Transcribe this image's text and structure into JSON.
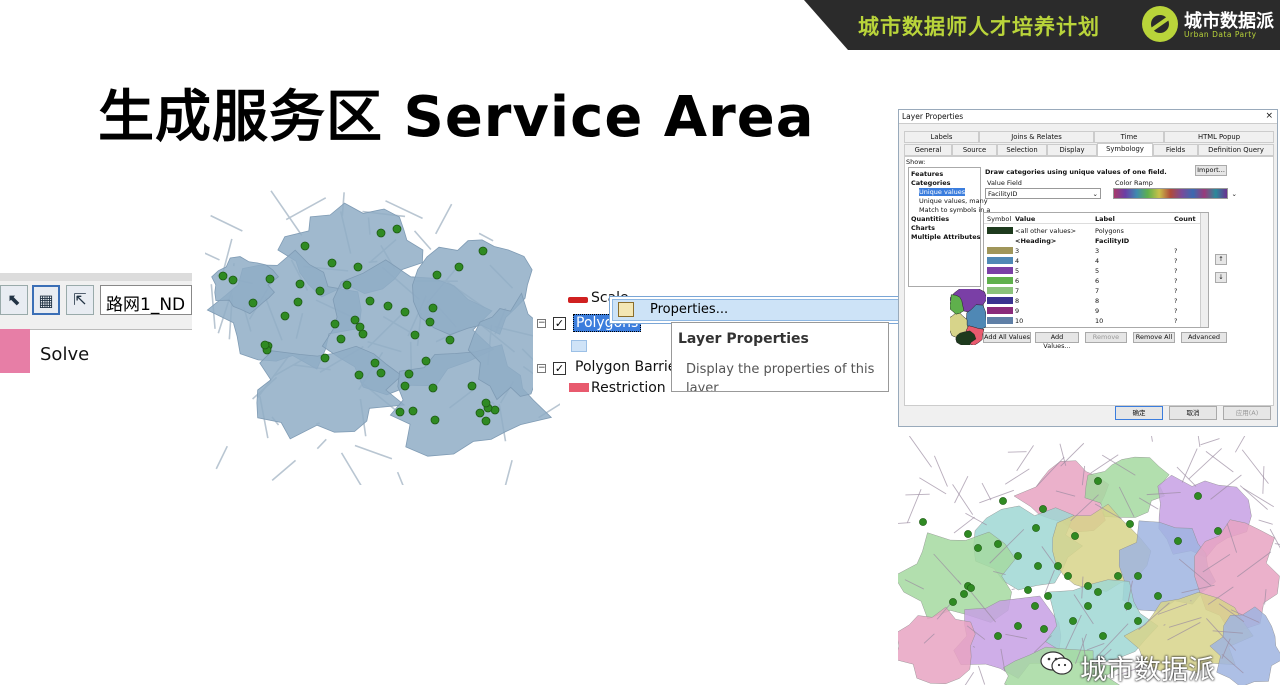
{
  "banner": {
    "slogan": "城市数据师人才培养计划",
    "brand_name": "城市数据派",
    "brand_sub": "Urban Data Party",
    "accent_color": "#b9d43a",
    "bg_color": "#2b2b2b"
  },
  "title": "生成服务区 Service Area",
  "toolbar": {
    "network_name": "路网1_ND",
    "solve_label": "Solve",
    "icons": [
      "select-tool-icon",
      "network-grid-icon",
      "export-icon"
    ]
  },
  "toc": {
    "rows": [
      {
        "label": "Scale",
        "icon": "line-symbol-icon"
      },
      {
        "label": "Polygons",
        "checked": true,
        "selected": true
      },
      {
        "label": "Polygon Barrie",
        "checked": true
      },
      {
        "label": "Restriction",
        "icon": "barrier-symbol-icon"
      }
    ]
  },
  "context_menu": {
    "item_label": "Properties...",
    "icon": "properties-icon"
  },
  "tooltip": {
    "title": "Layer Properties",
    "description": "Display the properties of this layer"
  },
  "dialog": {
    "title": "Layer Properties",
    "close_label": "×",
    "tabs_row1": [
      "Labels",
      "Joins & Relates",
      "Time",
      "HTML Popup"
    ],
    "tabs_row2": [
      "General",
      "Source",
      "Selection",
      "Display",
      "Symbology",
      "Fields",
      "Definition Query"
    ],
    "active_tab": "Symbology",
    "show_label": "Show:",
    "show_items": [
      {
        "label": "Features",
        "bold": true
      },
      {
        "label": "Categories",
        "bold": true
      },
      {
        "label": "Unique values",
        "indent": true,
        "selected": true
      },
      {
        "label": "Unique values, many",
        "indent": true
      },
      {
        "label": "Match to symbols in a",
        "indent": true
      },
      {
        "label": "Quantities",
        "bold": true
      },
      {
        "label": "Charts",
        "bold": true
      },
      {
        "label": "Multiple Attributes",
        "bold": true
      }
    ],
    "description": "Draw categories using unique values of one field.",
    "import_label": "Import...",
    "value_field_label": "Value Field",
    "value_field": "FacilityID",
    "color_ramp_label": "Color Ramp",
    "columns": [
      "Symbol",
      "Value",
      "Label",
      "Count"
    ],
    "rows": [
      {
        "value": "<all other values>",
        "label": "Polygons",
        "count": "",
        "color": "#1d3a1d"
      },
      {
        "value": "<Heading>",
        "label": "FacilityID",
        "count": "",
        "color": ""
      },
      {
        "value": "3",
        "label": "3",
        "count": "?",
        "color": "#a0965a"
      },
      {
        "value": "4",
        "label": "4",
        "count": "?",
        "color": "#4f88b5"
      },
      {
        "value": "5",
        "label": "5",
        "count": "?",
        "color": "#7a3fa6"
      },
      {
        "value": "6",
        "label": "6",
        "count": "?",
        "color": "#5fb04c"
      },
      {
        "value": "7",
        "label": "7",
        "count": "?",
        "color": "#8ac27a"
      },
      {
        "value": "8",
        "label": "8",
        "count": "?",
        "color": "#3a3290"
      },
      {
        "value": "9",
        "label": "9",
        "count": "?",
        "color": "#8a2a7a"
      },
      {
        "value": "10",
        "label": "10",
        "count": "?",
        "color": "#5f7fa6"
      }
    ],
    "buttons_row": [
      "Add All Values",
      "Add Values...",
      "Remove",
      "Remove All",
      "Advanced"
    ],
    "ok_label": "确定",
    "cancel_label": "取消",
    "apply_label": "应用(A)"
  },
  "map_colors": {
    "street_fill": "#8fadc6",
    "facility": "#2f8a22",
    "zones": [
      "#e7a3c2",
      "#a4d9a0",
      "#c7a0e4",
      "#9fd7d4",
      "#d7d48a",
      "#9fb4e0"
    ]
  },
  "watermark": {
    "label": "城市数据派"
  }
}
